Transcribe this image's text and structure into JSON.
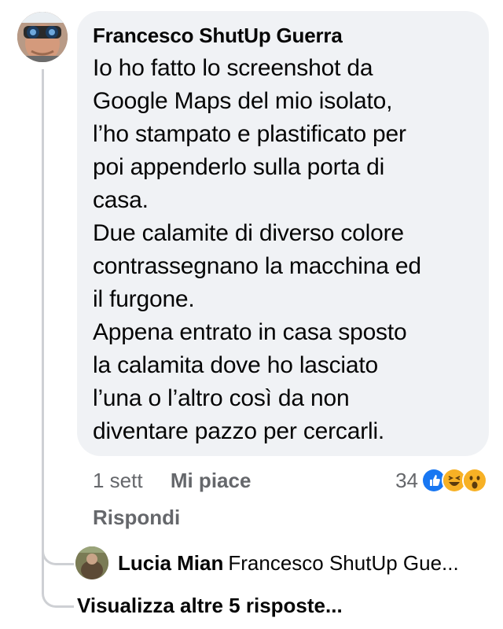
{
  "comment": {
    "author": "Francesco ShutUp Guerra",
    "text_lines": [
      "Io ho fatto lo screenshot da",
      "Google Maps del mio isolato,",
      "l’ho stampato e plastificato per",
      "poi appenderlo sulla porta di",
      "casa.",
      "Due calamite di diverso colore",
      "contrassegnano la macchina ed",
      "il furgone.",
      "Appena entrato in casa sposto",
      "la calamita dove ho lasciato",
      "l’una o l’altro così da non",
      "diventare pazzo per cercarli."
    ],
    "time": "1 sett",
    "like_label": "Mi piace",
    "reply_label": "Rispondi",
    "reaction_count": "34",
    "reactions": [
      "like-icon",
      "haha-icon",
      "wow-icon"
    ],
    "colors": {
      "like": "#1877f2",
      "haha": "#f7b125",
      "wow": "#f7b125"
    }
  },
  "reply": {
    "author": "Lucia Mian",
    "preview": "Francesco ShutUp Gue..."
  },
  "more_replies_label": "Visualizza altre 5 risposte..."
}
